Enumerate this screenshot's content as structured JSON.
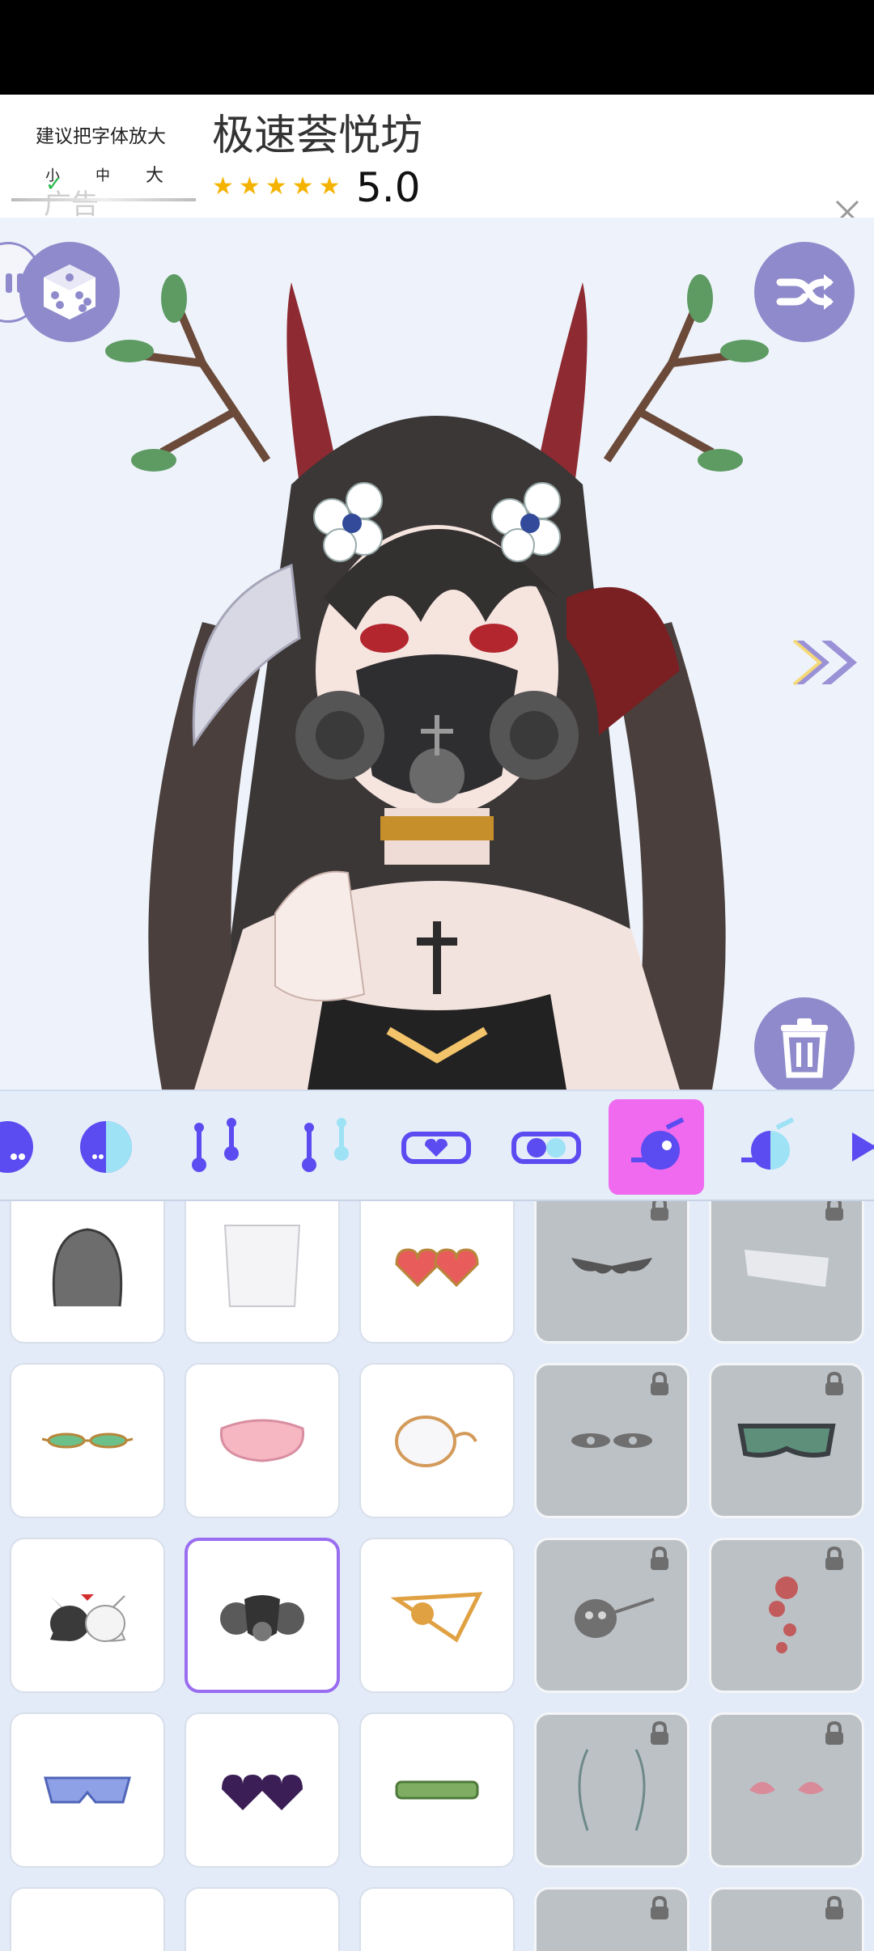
{
  "ad": {
    "hint": "建议把字体放大",
    "size_small": "小",
    "size_medium": "中",
    "size_large": "大",
    "ad_label": "广告",
    "app_name": "极速荟悦坊",
    "stars": "★★★★★",
    "rating": "5.0"
  },
  "toolbar": {
    "items": [
      "shirt-dot-icon",
      "half-circle-icon",
      "pin-pair-icon",
      "pin-pair-tilted-icon",
      "heart-glasses-icon",
      "split-glasses-icon",
      "face-accessory-icon",
      "face-accessory-alt-icon",
      "bow-icon"
    ],
    "active_index": 6
  },
  "grid": {
    "items": [
      {
        "name": "hairnet-item",
        "locked": false
      },
      {
        "name": "white-veil-item",
        "locked": false
      },
      {
        "name": "heart-sunglasses-item",
        "locked": false
      },
      {
        "name": "bat-wings-item",
        "locked": true
      },
      {
        "name": "bandage-item",
        "locked": true
      },
      {
        "name": "green-slim-glasses-item",
        "locked": false
      },
      {
        "name": "pink-sleep-mask-item",
        "locked": false
      },
      {
        "name": "monocle-item",
        "locked": false
      },
      {
        "name": "eye-marks-item",
        "locked": true
      },
      {
        "name": "ski-goggles-item",
        "locked": true
      },
      {
        "name": "cat-mask-item",
        "locked": false
      },
      {
        "name": "gas-mask-item",
        "locked": false,
        "selected": true
      },
      {
        "name": "eye-patch-gold-item",
        "locked": false
      },
      {
        "name": "skull-eyepatch-item",
        "locked": true
      },
      {
        "name": "rose-stickers-item",
        "locked": true
      },
      {
        "name": "blue-visor-item",
        "locked": false
      },
      {
        "name": "purple-heart-glasses-item",
        "locked": false
      },
      {
        "name": "bamboo-item",
        "locked": false
      },
      {
        "name": "antenna-lines-item",
        "locked": true
      },
      {
        "name": "pink-feathers-item",
        "locked": true
      }
    ]
  },
  "colors": {
    "accent": "#f06af0",
    "button": "#8f8acb",
    "selected_border": "#9a6df0",
    "locked_bg": "#bcc1c6"
  }
}
